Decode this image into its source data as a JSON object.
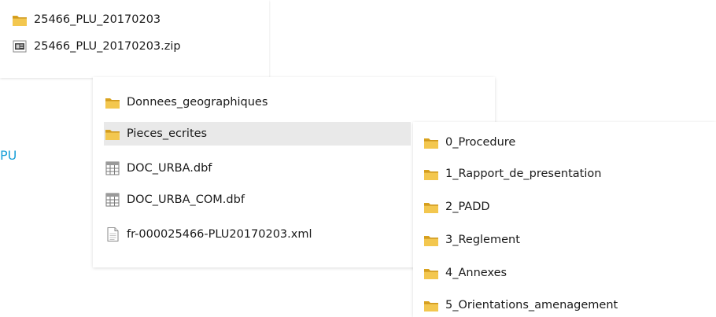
{
  "side_label": "PU",
  "panel_top": {
    "items": [
      {
        "label": "25466_PLU_20170203",
        "icon": "folder-icon"
      },
      {
        "label": "25466_PLU_20170203.zip",
        "icon": "zip-file-icon"
      }
    ]
  },
  "panel_middle": {
    "items": [
      {
        "label": "Donnees_geographiques",
        "icon": "folder-icon"
      },
      {
        "label": "Pieces_ecrites",
        "icon": "folder-icon",
        "selected": true
      },
      {
        "label": "DOC_URBA.dbf",
        "icon": "dbf-file-icon"
      },
      {
        "label": "DOC_URBA_COM.dbf",
        "icon": "dbf-file-icon"
      },
      {
        "label": "fr-000025466-PLU20170203.xml",
        "icon": "xml-file-icon"
      }
    ]
  },
  "panel_right": {
    "items": [
      {
        "label": "0_Procedure",
        "icon": "folder-icon"
      },
      {
        "label": "1_Rapport_de_presentation",
        "icon": "folder-icon"
      },
      {
        "label": "2_PADD",
        "icon": "folder-icon"
      },
      {
        "label": "3_Reglement",
        "icon": "folder-icon"
      },
      {
        "label": "4_Annexes",
        "icon": "folder-icon"
      },
      {
        "label": "5_Orientations_amenagement",
        "icon": "folder-icon"
      }
    ]
  },
  "colors": {
    "folder_front": "#f3c74f",
    "folder_back": "#d9a21e",
    "selection": "#e9e9e9",
    "side_label": "#1aa0d8"
  }
}
